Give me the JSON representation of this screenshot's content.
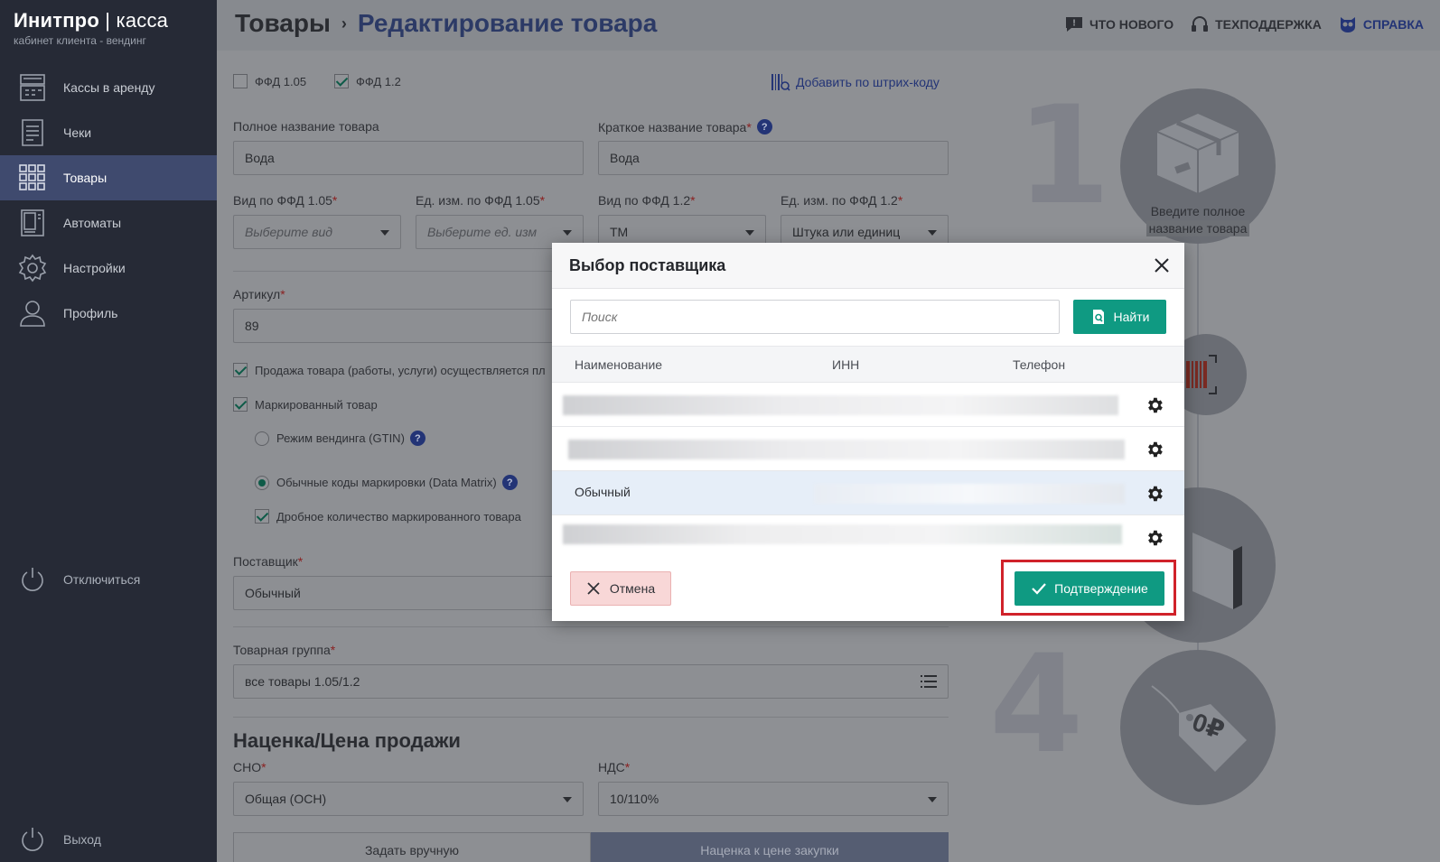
{
  "brand": {
    "name": "Инитпро",
    "name_suffix": "касса",
    "subtitle": "кабинет клиента - вендинг"
  },
  "sidebar": {
    "items": [
      {
        "label": "Кассы в аренду",
        "icon": "cash-register-icon"
      },
      {
        "label": "Чеки",
        "icon": "receipt-icon"
      },
      {
        "label": "Товары",
        "icon": "grid-icon",
        "active": true
      },
      {
        "label": "Автоматы",
        "icon": "vending-machine-icon"
      },
      {
        "label": "Настройки",
        "icon": "gear-icon"
      },
      {
        "label": "Профиль",
        "icon": "user-icon"
      }
    ],
    "disconnect_label": "Отключиться",
    "exit_label": "Выход"
  },
  "header": {
    "section": "Товары",
    "separator": "›",
    "current": "Редактирование товара",
    "links": {
      "whats_new": "ЧТО НОВОГО",
      "support": "ТЕХПОДДЕРЖКА",
      "help": "СПРАВКА"
    }
  },
  "form": {
    "ffd105_label": "ФФД 1.05",
    "ffd12_label": "ФФД 1.2",
    "add_by_barcode": "Добавить по штрих-коду",
    "full_name_label": "Полное название товара",
    "full_name_value": "Вода",
    "short_name_label": "Краткое название товара",
    "short_name_value": "Вода",
    "type105_label": "Вид по ФФД 1.05",
    "type105_placeholder": "Выберите вид",
    "unit105_label": "Ед. изм. по ФФД 1.05",
    "unit105_placeholder": "Выберите ед. изм",
    "type12_label": "Вид по ФФД 1.2",
    "type12_value": "ТМ",
    "unit12_label": "Ед. изм. по ФФД 1.2",
    "unit12_value": "Штука или единиц",
    "article_label": "Артикул",
    "article_value": "89",
    "sale_check_label": "Продажа товара (работы, услуги) осуществляется пл",
    "marked_label": "Маркированный товар",
    "vending_mode_label": "Режим вендинга (GTIN)",
    "regular_codes_label": "Обычные коды маркировки (Data Matrix)",
    "fractional_label": "Дробное количество маркированного товара",
    "supplier_label": "Поставщик",
    "supplier_value": "Обычный",
    "group_label": "Товарная группа",
    "group_value": "все товары 1.05/1.2",
    "markup_section": "Наценка/Цена продажи",
    "sno_label": "СНО",
    "sno_value": "Общая (ОСН)",
    "nds_label": "НДС",
    "nds_value": "10/110%",
    "manual_tab": "Задать вручную",
    "markup_tab": "Наценка к цене закупки",
    "required_mark": "*"
  },
  "steps": {
    "step1_number": "1",
    "step1_caption_line1": "Введите полное",
    "step1_caption_line2": "название товара",
    "step4_number": "4",
    "price_tag_text": "0₽"
  },
  "modal": {
    "title": "Выбор поставщика",
    "search_placeholder": "Поиск",
    "find_label": "Найти",
    "columns": {
      "name": "Наименование",
      "inn": "ИНН",
      "phone": "Телефон"
    },
    "rows": [
      {
        "name": "",
        "selected": false
      },
      {
        "name": "",
        "selected": false
      },
      {
        "name": "Обычный",
        "selected": true
      },
      {
        "name": "",
        "selected": false
      }
    ],
    "cancel_label": "Отмена",
    "confirm_label": "Подтверждение"
  },
  "colors": {
    "accent_green": "#0f9a82",
    "highlight_red": "#d0222a",
    "sidebar_bg": "#262a36",
    "active_nav": "#3f4a6e"
  }
}
